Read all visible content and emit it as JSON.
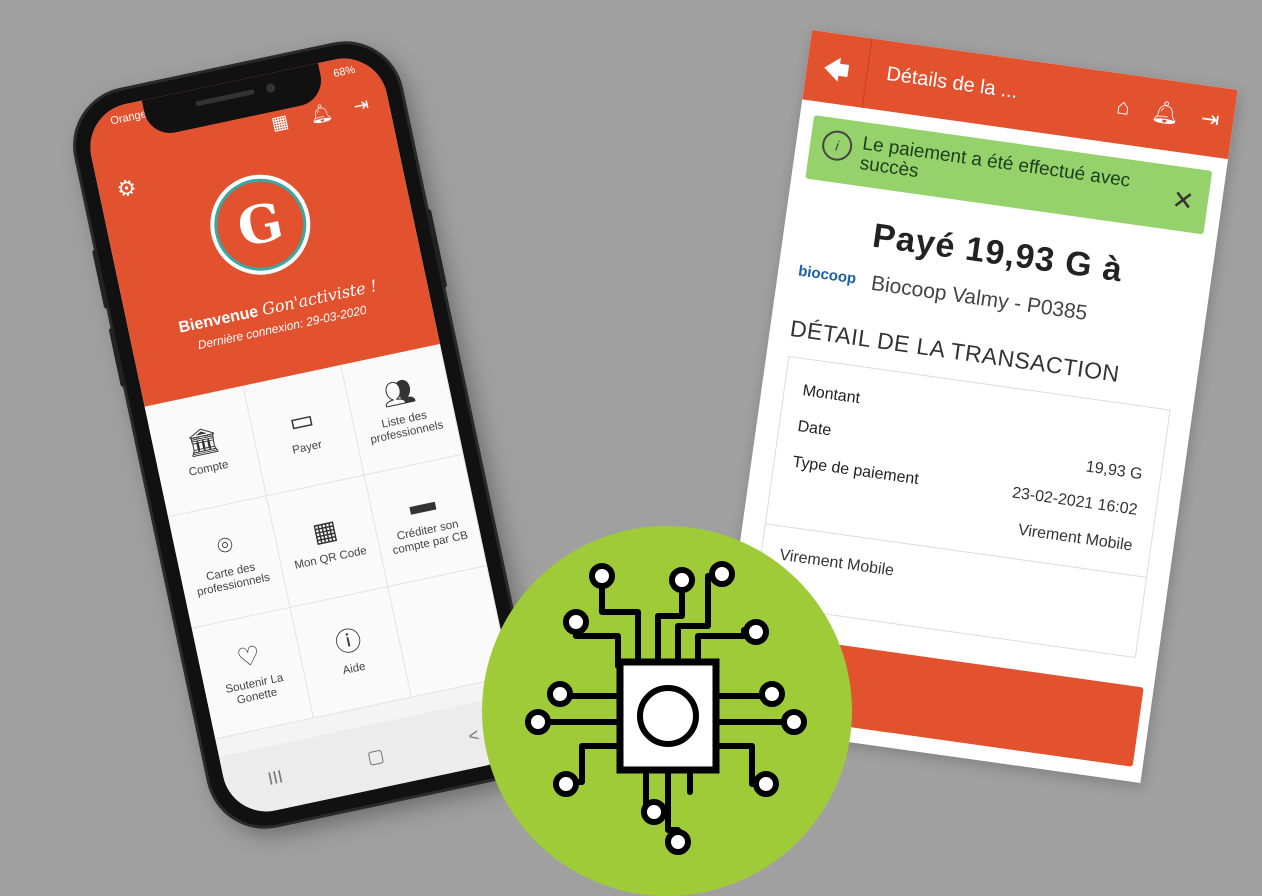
{
  "phone": {
    "status_left": "Orange F",
    "status_right": "68%",
    "welcome_prefix": "Bienvenue",
    "welcome_name": "Gon'activiste !",
    "last_login": "Dernière connexion: 29-03-2020",
    "grid": [
      {
        "icon": "bank-icon",
        "label": "Compte"
      },
      {
        "icon": "wallet-icon",
        "label": "Payer"
      },
      {
        "icon": "people-icon",
        "label": "Liste des professionnels"
      },
      {
        "icon": "map-pin-icon",
        "label": "Carte des professionnels"
      },
      {
        "icon": "qr-code-icon",
        "label": "Mon QR Code"
      },
      {
        "icon": "credit-card-icon",
        "label": "Créditer son compte par CB"
      },
      {
        "icon": "heart-icon",
        "label": "Soutenir La Gonette"
      },
      {
        "icon": "question-icon",
        "label": "Aide"
      }
    ],
    "nav": [
      "III",
      "▢",
      "<"
    ]
  },
  "receipt": {
    "title": "Détails de la ...",
    "alert": "Le paiement a été effectué avec succès",
    "paid": "Payé 19,93 G à",
    "merchant_logo": "biocoop",
    "merchant": "Biocoop Valmy - P0385",
    "section": "DÉTAIL DE LA TRANSACTION",
    "rows": [
      {
        "label": "Montant",
        "value": ""
      },
      {
        "label": "Date",
        "value": "19,93 G"
      },
      {
        "label": "Type de paiement",
        "value": "23-02-2021 16:02"
      },
      {
        "label": "",
        "value": "Virement Mobile"
      }
    ],
    "footer_value": "Virement Mobile"
  },
  "colors": {
    "brand_orange": "#e2522f",
    "success_green": "#95d26b",
    "badge_green": "#9fcb39",
    "background": "#a0a0a0"
  }
}
